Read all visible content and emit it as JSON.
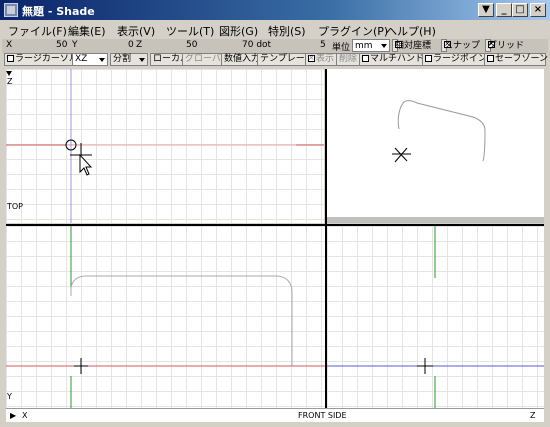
{
  "window": {
    "title": "無題 - Shade",
    "minimize_label": "_",
    "maximize_label": "□",
    "close_label": "×"
  },
  "menu": [
    {
      "label": "ファイル(F)"
    },
    {
      "label": "編集(E)"
    },
    {
      "label": "表示(V)"
    },
    {
      "label": "ツール(T)"
    },
    {
      "label": "図形(G)"
    },
    {
      "label": "特別(S)"
    },
    {
      "label": "プラグイン(P)"
    },
    {
      "label": "ヘルプ(H)"
    }
  ],
  "coords": {
    "x_label": "X",
    "x_value": "50",
    "y_label": "Y",
    "y_value": "0",
    "z_label": "Z",
    "z_value": "50",
    "dot_value": "70 dot",
    "unit_num": "5",
    "unit_label": "単位",
    "unit_value": "mm",
    "relative_label": "相対座標",
    "snap_label": "スナップ",
    "grid_label": "グリッド"
  },
  "toolbar": {
    "large_cursor": "ラージカーソル",
    "plane_value": "XZ",
    "split_label": "分割",
    "local_label": "ローカル",
    "global_label": "グローバル",
    "numeric_input": "数値入力",
    "template_label": "テンプレート",
    "show_label": "表示",
    "delete_label": "削除",
    "multi_handle": "マルチハンドル",
    "large_point": "ラージポイント",
    "safe_zone": "セーフゾーン"
  },
  "views": {
    "top_axis_z": "Z",
    "top_label": "TOP",
    "front_axis_y": "Y",
    "front_axis_x": "X",
    "front_side_label": "FRONT SIDE",
    "side_axis_z": "Z"
  },
  "colors": {
    "red_axis": "#d25a5a",
    "blue_axis": "#5a5ad2",
    "green_axis": "#2a9a2a"
  }
}
